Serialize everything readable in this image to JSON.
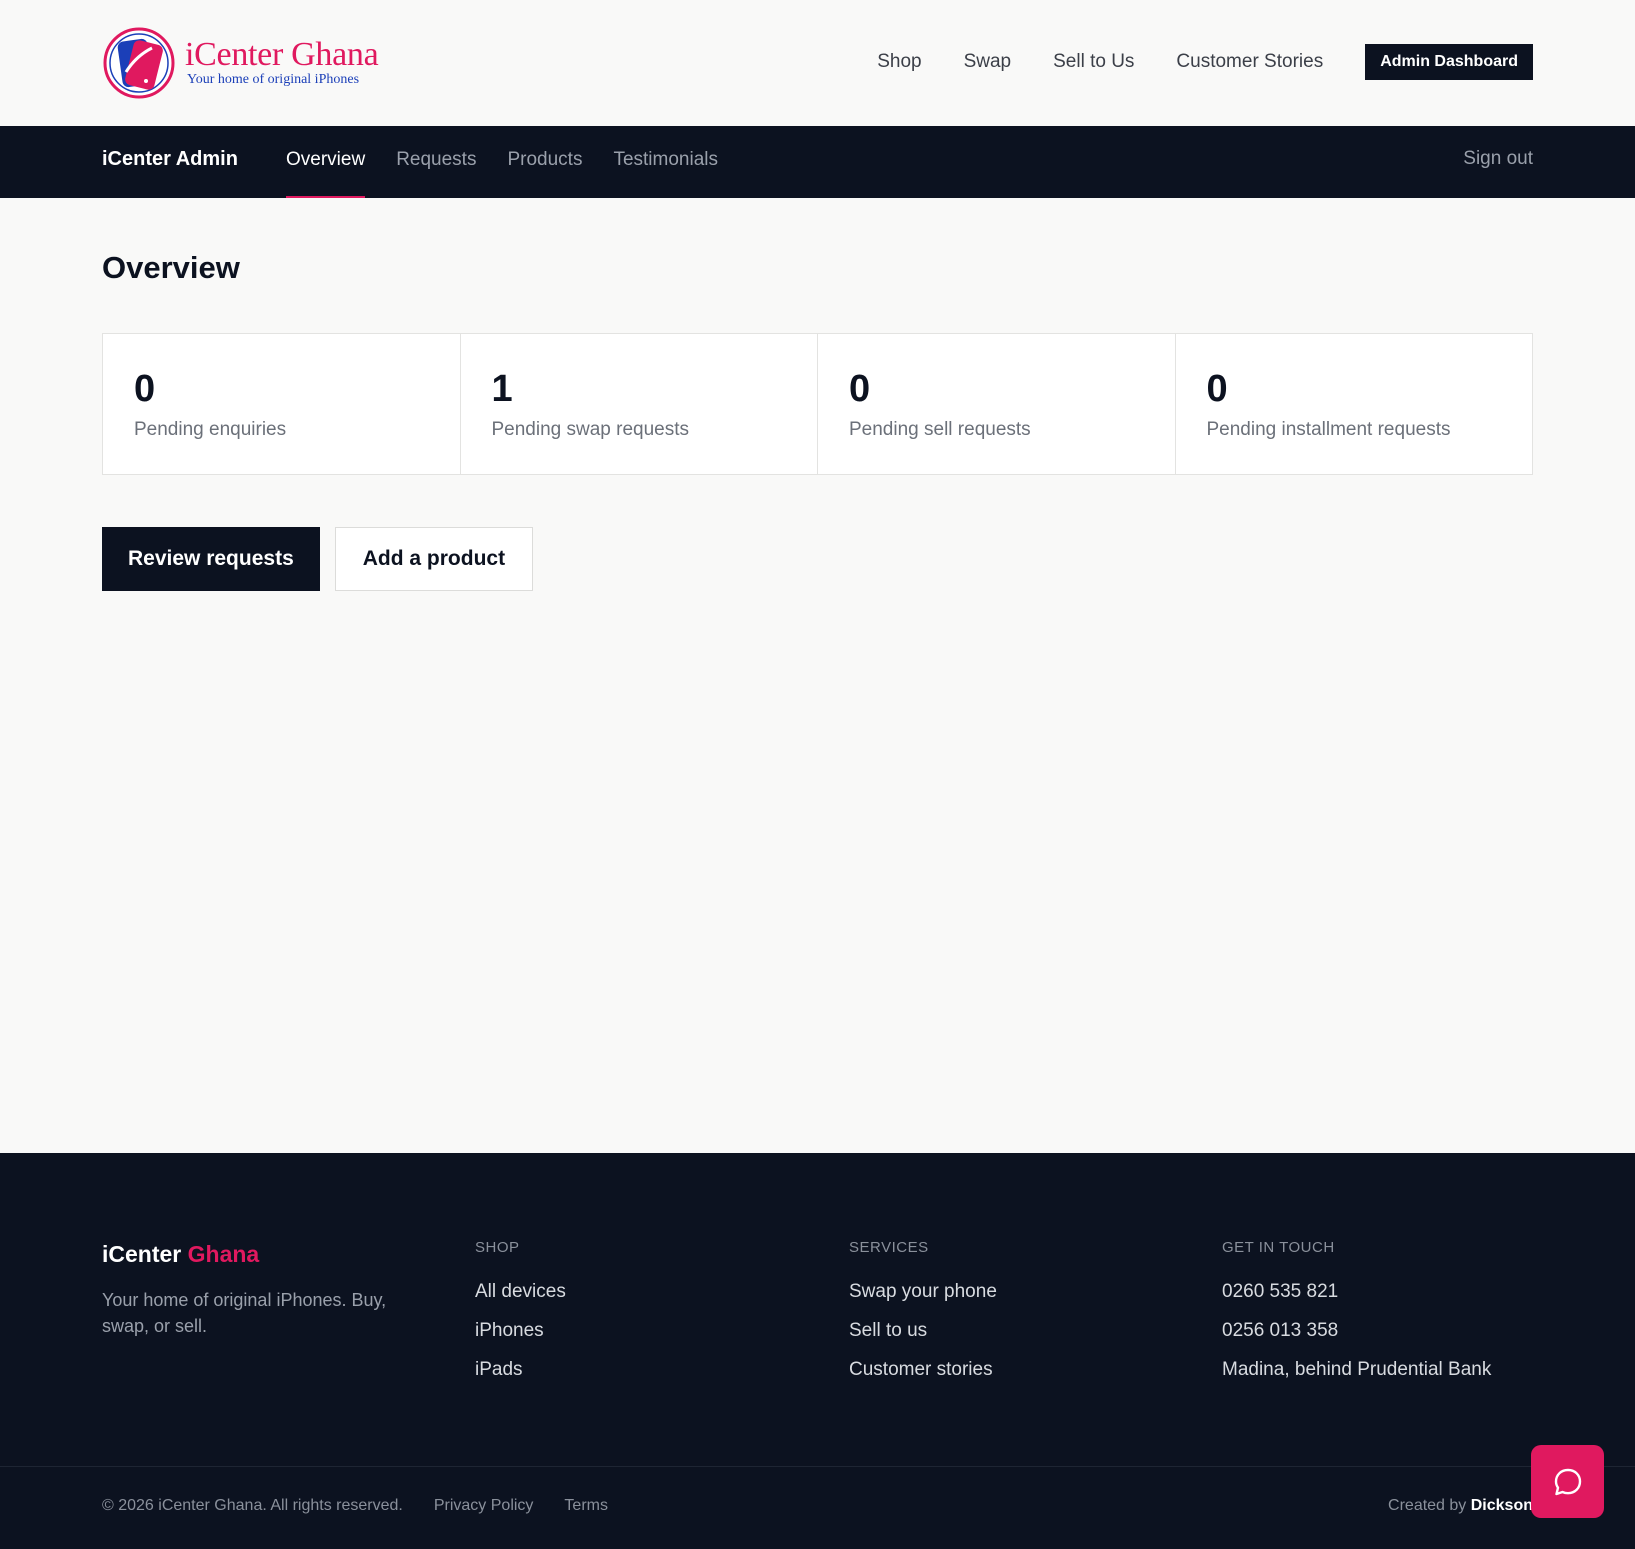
{
  "brand": {
    "name": "iCenter Ghana",
    "tagline": "Your home of original iPhones",
    "colors": {
      "accent": "#e0195f",
      "dark": "#0c1220",
      "blue": "#1b3fb8"
    }
  },
  "topnav": {
    "links": [
      "Shop",
      "Swap",
      "Sell to Us",
      "Customer Stories"
    ],
    "admin_button": "Admin Dashboard"
  },
  "adminbar": {
    "title": "iCenter Admin",
    "tabs": [
      "Overview",
      "Requests",
      "Products",
      "Testimonials"
    ],
    "active_tab": "Overview",
    "signout": "Sign out"
  },
  "main": {
    "title": "Overview",
    "stats": [
      {
        "value": "0",
        "label": "Pending enquiries"
      },
      {
        "value": "1",
        "label": "Pending swap requests"
      },
      {
        "value": "0",
        "label": "Pending sell requests"
      },
      {
        "value": "0",
        "label": "Pending installment requests"
      }
    ],
    "primary_action": "Review requests",
    "secondary_action": "Add a product"
  },
  "footer": {
    "brand_first": "iCenter",
    "brand_second": "Ghana",
    "tagline": "Your home of original iPhones. Buy, swap, or sell.",
    "columns": [
      {
        "heading": "SHOP",
        "links": [
          "All devices",
          "iPhones",
          "iPads"
        ]
      },
      {
        "heading": "SERVICES",
        "links": [
          "Swap your phone",
          "Sell to us",
          "Customer stories"
        ]
      },
      {
        "heading": "GET IN TOUCH",
        "links": [
          "0260 535 821",
          "0256 013 358",
          "Madina, behind Prudential Bank"
        ]
      }
    ],
    "copyright": "© 2026 iCenter Ghana. All rights reserved.",
    "privacy": "Privacy Policy",
    "terms": "Terms",
    "credit_prefix": "Created by",
    "credit_name": "Dickson"
  },
  "chat": {
    "icon": "chat-bubble-icon"
  }
}
